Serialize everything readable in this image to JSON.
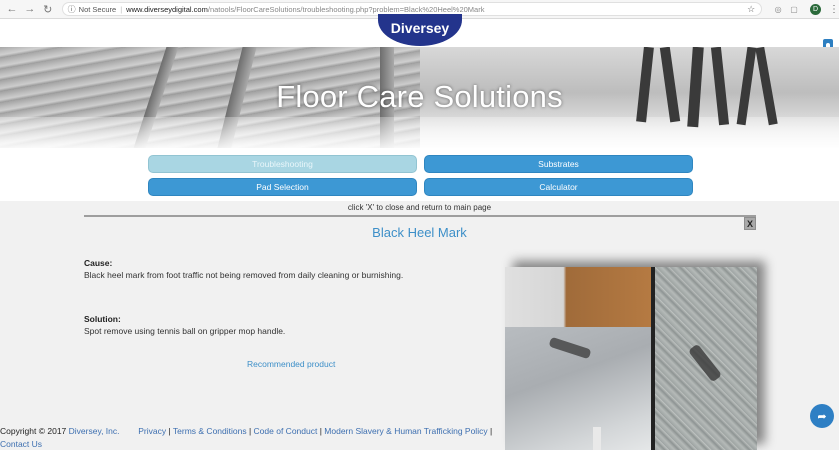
{
  "browser": {
    "security_label": "Not Secure",
    "url_host": "www.diverseydigital.com",
    "url_path": "/natools/FloorCareSolutions/troubleshooting.php?problem=Black%20Heel%20Mark",
    "avatar_letter": "D"
  },
  "site": {
    "logo_text": "Diversey",
    "hero_title": "Floor Care Solutions"
  },
  "nav": {
    "troubleshooting": "Troubleshooting",
    "substrates": "Substrates",
    "pad_selection": "Pad Selection",
    "calculator": "Calculator"
  },
  "content": {
    "close_hint": "click 'X' to close and return to main page",
    "close_label": "X",
    "title": "Black Heel Mark",
    "cause_label": "Cause:",
    "cause_text": "Black heel mark from foot traffic not being removed from daily cleaning or burnishing.",
    "solution_label": "Solution:",
    "solution_text": "Spot remove using tennis ball on gripper mop handle.",
    "recommended_link": "Recommended product"
  },
  "footer": {
    "copyright": "Copyright © 2017 ",
    "company": "Diversey, Inc.",
    "privacy": "Privacy",
    "terms": "Terms & Conditions",
    "conduct": "Code of Conduct",
    "slavery": "Modern Slavery & Human Trafficking Policy",
    "contact": "Contact Us"
  },
  "colors": {
    "accent": "#3d98d4",
    "active_tab": "#a9d6e3",
    "logo": "#23348c",
    "link": "#3d8fc8"
  },
  "icons": [
    "back-arrow-icon",
    "forward-arrow-icon",
    "reload-icon",
    "info-icon",
    "star-icon",
    "extension-icon",
    "menu-dots-icon",
    "bookmark-icon",
    "share-icon",
    "close-icon"
  ]
}
